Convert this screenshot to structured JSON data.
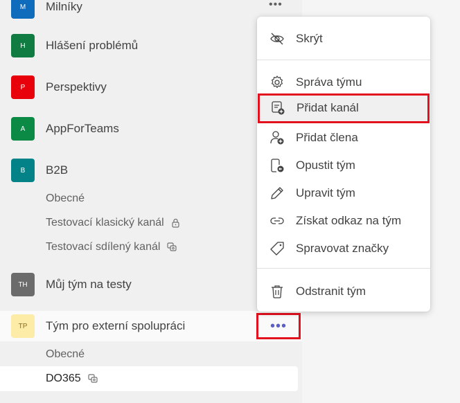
{
  "sidebar": {
    "teams": [
      {
        "initials": "M",
        "name": "Milníky",
        "color": "#0f6cbd"
      },
      {
        "initials": "H",
        "name": "Hlášení problémů",
        "color": "#107c41"
      },
      {
        "initials": "P",
        "name": "Perspektivy",
        "color": "#e8000b"
      },
      {
        "initials": "A",
        "name": "AppForTeams",
        "color": "#0b8a45"
      },
      {
        "initials": "B",
        "name": "B2B",
        "color": "#038387"
      },
      {
        "initials": "TH",
        "name": "Můj tým na testy",
        "color": "#6b6b6b"
      },
      {
        "initials": "TP",
        "name": "Tým pro externí spolupráci",
        "color": "#fdeba8",
        "text_color": "#8a6d1e"
      }
    ],
    "b2b_channels": [
      {
        "name": "Obecné"
      },
      {
        "name": "Testovací klasický kanál",
        "icon": "lock-icon"
      },
      {
        "name": "Testovací sdílený kanál",
        "icon": "shared-channel-icon"
      }
    ],
    "external_channels": [
      {
        "name": "Obecné"
      },
      {
        "name": "DO365",
        "icon": "shared-channel-icon"
      }
    ],
    "more_options": "•••",
    "top_dots": "•••"
  },
  "context_menu": {
    "items": [
      {
        "label": "Skrýt",
        "icon": "hide-icon"
      },
      {
        "label": "Správa týmu",
        "icon": "gear-icon"
      },
      {
        "label": "Přidat kanál",
        "icon": "add-channel-icon"
      },
      {
        "label": "Přidat člena",
        "icon": "add-member-icon"
      },
      {
        "label": "Opustit tým",
        "icon": "leave-team-icon"
      },
      {
        "label": "Upravit tým",
        "icon": "pencil-icon"
      },
      {
        "label": "Získat odkaz na tým",
        "icon": "link-icon"
      },
      {
        "label": "Spravovat značky",
        "icon": "tag-icon"
      },
      {
        "label": "Odstranit tým",
        "icon": "trash-icon"
      }
    ]
  },
  "colors": {
    "highlight_border": "#e3101e",
    "accent": "#5b5fc7"
  }
}
